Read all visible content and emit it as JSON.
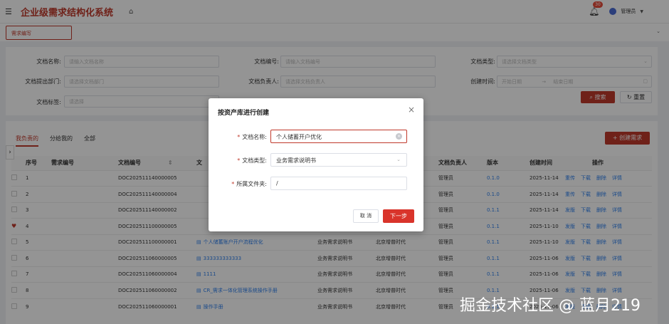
{
  "header": {
    "menu_icon": "menu-fold-icon",
    "title": "企业级需求结构化系统",
    "home_icon": "home-icon",
    "notification_count": "30",
    "username": "管理员"
  },
  "tabbar": {
    "active_tab": "需求编写"
  },
  "filter": {
    "fields": [
      {
        "label": "文档名称:",
        "placeholder": "请输入文档名称"
      },
      {
        "label": "文档编号:",
        "placeholder": "请输入文档编号"
      },
      {
        "label": "文档类型:",
        "placeholder": "请选择文档类型"
      },
      {
        "label": "文档提出部门:",
        "placeholder": "请选择文档部门"
      },
      {
        "label": "文档负责人:",
        "placeholder": "请选择文档负责人"
      },
      {
        "label": "创建时间:",
        "placeholder": "开始日期"
      },
      {
        "label": "文档标签:",
        "placeholder": "请选择"
      }
    ],
    "date_separator": "→",
    "end_date_placeholder": "结束日期",
    "search_label": "搜索",
    "reset_label": "重置"
  },
  "list": {
    "tabs": [
      "我负责的",
      "分给我的",
      "全部"
    ],
    "create_label": "+ 创建需求",
    "columns": [
      "序号",
      "需求编号",
      "文档编号",
      "文",
      "",
      "",
      "文档负责人",
      "版本",
      "创建时间",
      "操作"
    ],
    "rows": [
      {
        "idx": "1",
        "doc": "DOC202511140000005",
        "name": "",
        "type": "",
        "dept": "",
        "owner": "管理员",
        "ver": "0.1.0",
        "time": "2025-11-14",
        "ops": [
          "重传",
          "下载",
          "删除",
          "详情"
        ]
      },
      {
        "idx": "2",
        "doc": "DOC202511140000004",
        "name": "",
        "type": "",
        "dept": "",
        "owner": "管理员",
        "ver": "0.1.0",
        "time": "2025-11-14",
        "ops": [
          "重传",
          "下载",
          "删除",
          "详情"
        ]
      },
      {
        "idx": "3",
        "doc": "DOC202511140000002",
        "name": "",
        "type": "",
        "dept": "",
        "owner": "管理员",
        "ver": "0.1.1",
        "time": "2025-11-14",
        "ops": [
          "发版",
          "下载",
          "删除",
          "详情"
        ]
      },
      {
        "idx": "4",
        "doc": "DOC202511100000005",
        "name": "",
        "type": "",
        "dept": "",
        "owner": "管理员",
        "ver": "0.1.1",
        "time": "2025-11-10",
        "ops": [
          "发版",
          "下载",
          "删除",
          "详情"
        ]
      },
      {
        "idx": "5",
        "doc": "DOC202511100000001",
        "name": "个人储蓄账户开户流程优化",
        "type": "业务需求说明书",
        "dept": "北京增普时代",
        "owner": "管理员",
        "ver": "0.1.1",
        "time": "2025-11-10",
        "ops": [
          "发版",
          "下载",
          "删除",
          "详情"
        ]
      },
      {
        "idx": "6",
        "doc": "DOC202511060000005",
        "name": "333333333333",
        "type": "业务需求说明书",
        "dept": "北京增普时代",
        "owner": "管理员",
        "ver": "0.1.1",
        "time": "2025-11-06",
        "ops": [
          "发版",
          "下载",
          "删除",
          "详情"
        ]
      },
      {
        "idx": "7",
        "doc": "DOC202511060000004",
        "name": "1111",
        "type": "业务需求说明书",
        "dept": "北京增普时代",
        "owner": "管理员",
        "ver": "0.1.1",
        "time": "2025-11-06",
        "ops": [
          "发版",
          "下载",
          "删除",
          "详情"
        ]
      },
      {
        "idx": "8",
        "doc": "DOC202511060000002",
        "name": "CR_需求一体化管理系统操作手册",
        "type": "业务需求说明书",
        "dept": "北京增普时代",
        "owner": "管理员",
        "ver": "0.1.1",
        "time": "2025-11-06",
        "ops": [
          "发版",
          "下载",
          "删除",
          "详情"
        ]
      },
      {
        "idx": "9",
        "doc": "DOC202511060000001",
        "name": "操作手册",
        "type": "业务需求说明书",
        "dept": "北京增普时代",
        "owner": "管理员",
        "ver": "0.1.1",
        "time": "2025-11-06",
        "ops": [
          "发版",
          "下载",
          "删除",
          "详情"
        ]
      }
    ]
  },
  "modal": {
    "title": "按资产库进行创建",
    "fields": [
      {
        "label": "文档名称:",
        "value": "个人储蓄开户优化"
      },
      {
        "label": "文档类型:",
        "value": "业务需求说明书"
      },
      {
        "label": "所属文件夹:",
        "value": "/"
      }
    ],
    "required_mark": "*",
    "cancel_label": "取 消",
    "next_label": "下一步"
  },
  "watermark": "掘金技术社区 @ 蓝月219"
}
